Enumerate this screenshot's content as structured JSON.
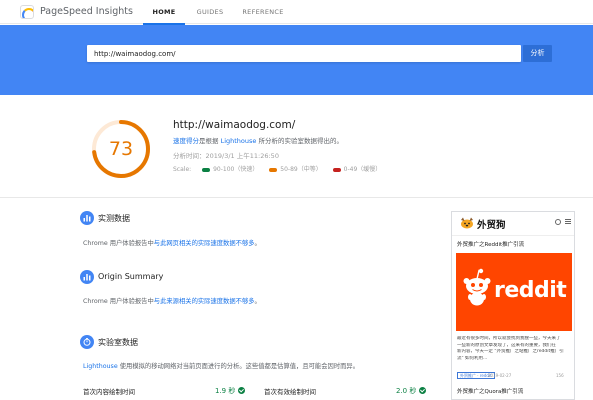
{
  "app": {
    "brand": "PageSpeed Insights",
    "tabs": [
      {
        "label": "HOME",
        "active": true
      },
      {
        "label": "GUIDES",
        "active": false
      },
      {
        "label": "REFERENCE",
        "active": false
      }
    ]
  },
  "search": {
    "url_value": "http://waimaodog.com/",
    "analyze_label": "分析"
  },
  "summary": {
    "score": "73",
    "score_fraction": 0.73,
    "score_color": "#e67700",
    "url": "http://waimaodog.com/",
    "desc_link1": "速度得分",
    "desc_mid": "是根据 ",
    "desc_link2": "Lighthouse",
    "desc_tail": " 所分析的实验室数据得出的。",
    "time": "分析时间：2019/3/1 上午11:26:50",
    "legend_label": "Scale:",
    "legend": [
      {
        "label": "90-100（快速）",
        "color": "#0b8043"
      },
      {
        "label": "50-89（中等）",
        "color": "#e67700"
      },
      {
        "label": "0-49（缓慢）",
        "color": "#c5221f"
      }
    ]
  },
  "field_data": {
    "title": "实测数据",
    "text_prefix": "Chrome 用户体验报告中",
    "text_link": "与此网页相关的实际速度数据不够多",
    "text_suffix": "。"
  },
  "origin_summary": {
    "title": "Origin Summary",
    "text_prefix": "Chrome 用户体验报告中",
    "text_link": "与此来源相关的实际速度数据不够多",
    "text_suffix": "。"
  },
  "lab_data": {
    "title": "实验室数据",
    "text_link": "Lighthouse",
    "text_rest": " 使用模拟的移动网络对当前页面进行的分析。这些值都是估算值，且可能会因时而异。",
    "metrics": [
      {
        "label": "首次内容绘制时间",
        "value": "1.9 秒"
      },
      {
        "label": "首次有效绘制时间",
        "value": "2.0 秒"
      }
    ]
  },
  "preview": {
    "brand": "外贸狗",
    "article_title": "外贸推广之Reddit推广引流",
    "image_word": "reddit",
    "snippet": [
      "最近有很多时间，所以就会找到我搜一些，今天来了",
      "一些新的原创文章发现了，这来有的重要，我们在",
      "新内容，今天一定 \"外贸推广之站推广之reddit推广引",
      "流\" 如何利用..."
    ],
    "tag": "外贸推广 · reddit",
    "date": "2019-02-27",
    "views": "156",
    "article2_title": "外贸推广之Quora推广引流"
  }
}
